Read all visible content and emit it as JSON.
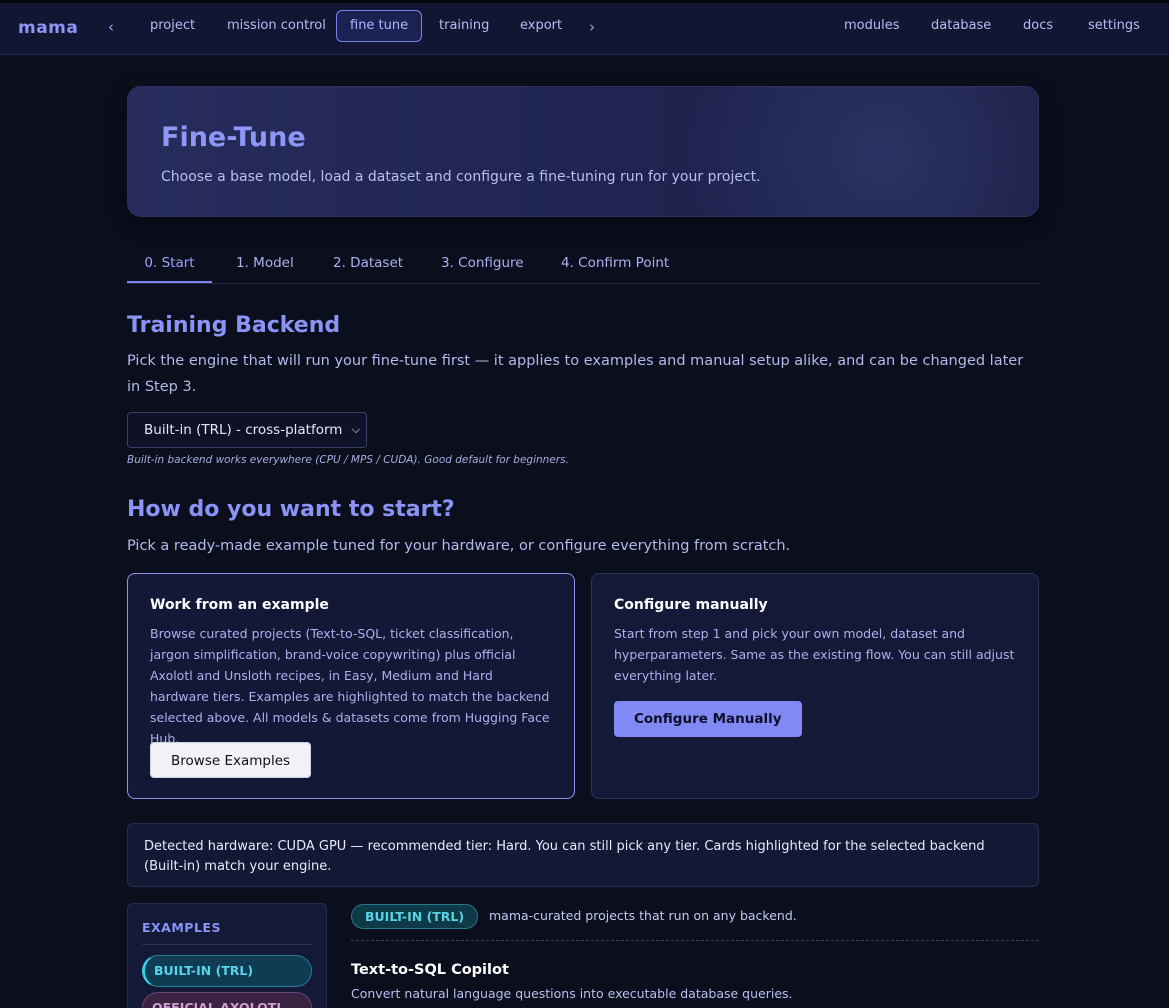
{
  "nav": {
    "brand": "mama",
    "prev": "‹",
    "next": "›",
    "left_links": [
      "project",
      "mission control",
      "fine tune",
      "training",
      "export"
    ],
    "active": "fine tune",
    "right_links": [
      "modules",
      "database",
      "docs",
      "settings"
    ]
  },
  "hero": {
    "title": "Fine-Tune",
    "subtitle": "Choose a base model, load a dataset and configure a fine-tuning run for your project."
  },
  "tabs": [
    "0. Start",
    "1. Model",
    "2. Dataset",
    "3. Configure",
    "4. Confirm Point"
  ],
  "active_tab": "0. Start",
  "backend": {
    "heading": "Training Backend",
    "description": "Pick the engine that will run your fine-tune first — it applies to examples and manual setup alike, and can be changed later in Step 3.",
    "selected": "Built-in (TRL) - cross-platform",
    "hint": "Built-in backend works everywhere (CPU / MPS / CUDA). Good default for beginners."
  },
  "start": {
    "heading": "How do you want to start?",
    "description": "Pick a ready-made example tuned for your hardware, or configure everything from scratch."
  },
  "cards": {
    "example": {
      "title": "Work from an example",
      "body": "Browse curated projects (Text-to-SQL, ticket classification, jargon simplification, brand-voice copywriting) plus official Axolotl and Unsloth recipes, in Easy, Medium and Hard hardware tiers. Examples are highlighted to match the backend selected above. All models & datasets come from Hugging Face Hub.",
      "button": "Browse Examples"
    },
    "manual": {
      "title": "Configure manually",
      "body": "Start from step 1 and pick your own model, dataset and hyperparameters. Same as the existing flow. You can still adjust everything later.",
      "button": "Configure Manually"
    }
  },
  "hardware": {
    "text": "Detected hardware: CUDA GPU — recommended tier: Hard. You can still pick any tier. Cards highlighted for the selected backend (Built-in) match your engine."
  },
  "examples": {
    "sidebar_title": "EXAMPLES",
    "filters": [
      "BUILT-IN (TRL)",
      "OFFICIAL AXOLOTL"
    ],
    "section_tag": "BUILT-IN (TRL)",
    "section_desc": "mama-curated projects that run on any backend.",
    "items": [
      {
        "title": "Text-to-SQL Copilot",
        "desc": "Convert natural language questions into executable database queries."
      }
    ]
  },
  "colors": {
    "background": "#0b0e1c",
    "accent": "#8a93f6",
    "primary_button": "#8189f4",
    "trl_tag": "#58d3e6",
    "axolotl_tag": "#cf9fd3"
  }
}
